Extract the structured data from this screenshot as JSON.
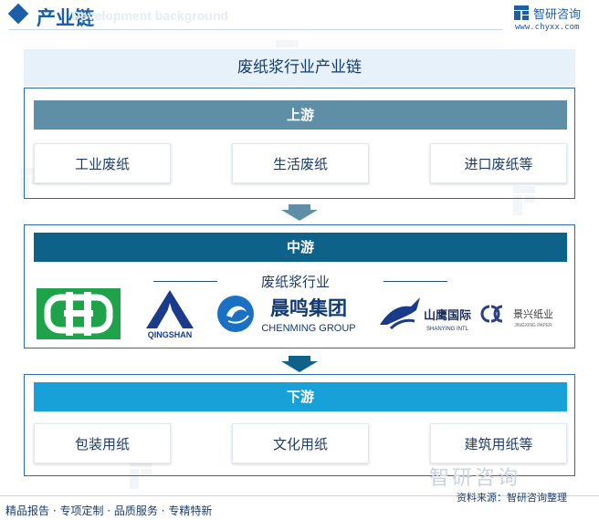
{
  "header": {
    "title": "产业链",
    "ghost_text": "Development background",
    "brand_name": "智研咨询",
    "brand_url": "www.chyxx.com"
  },
  "diagram": {
    "title": "废纸浆行业产业链",
    "upstream": {
      "label": "上游",
      "items": [
        "工业废纸",
        "生活废纸",
        "进口废纸等"
      ],
      "color": "#5e8fa6"
    },
    "midstream": {
      "label": "中游",
      "industry_label": "废纸浆行业",
      "color": "#0e6189",
      "companies": [
        {
          "name": "ZhongHua logo",
          "text": ""
        },
        {
          "name": "QingShan",
          "text": "QINGSHAN"
        },
        {
          "name": "Chenming",
          "text_cn": "晨鸣集团",
          "text_en": "CHENMING GROUP"
        },
        {
          "name": "Shanying",
          "text_cn": "山鹰国际",
          "text_en": "SHANYING INTL"
        },
        {
          "name": "Jingxing",
          "text_cn": "景兴纸业",
          "text_en": "JINGXING PAPER"
        }
      ]
    },
    "downstream": {
      "label": "下游",
      "items": [
        "包装用纸",
        "文化用纸",
        "建筑用纸等"
      ],
      "color": "#18a1d8"
    }
  },
  "footer": {
    "left": "精品报告 · 专项定制 · 品质服务 · 专精特新",
    "right": "资料来源：智研咨询整理",
    "watermark": "智研咨询"
  },
  "colors": {
    "brand": "#1b5fa8",
    "border": "#2a6aa8"
  }
}
